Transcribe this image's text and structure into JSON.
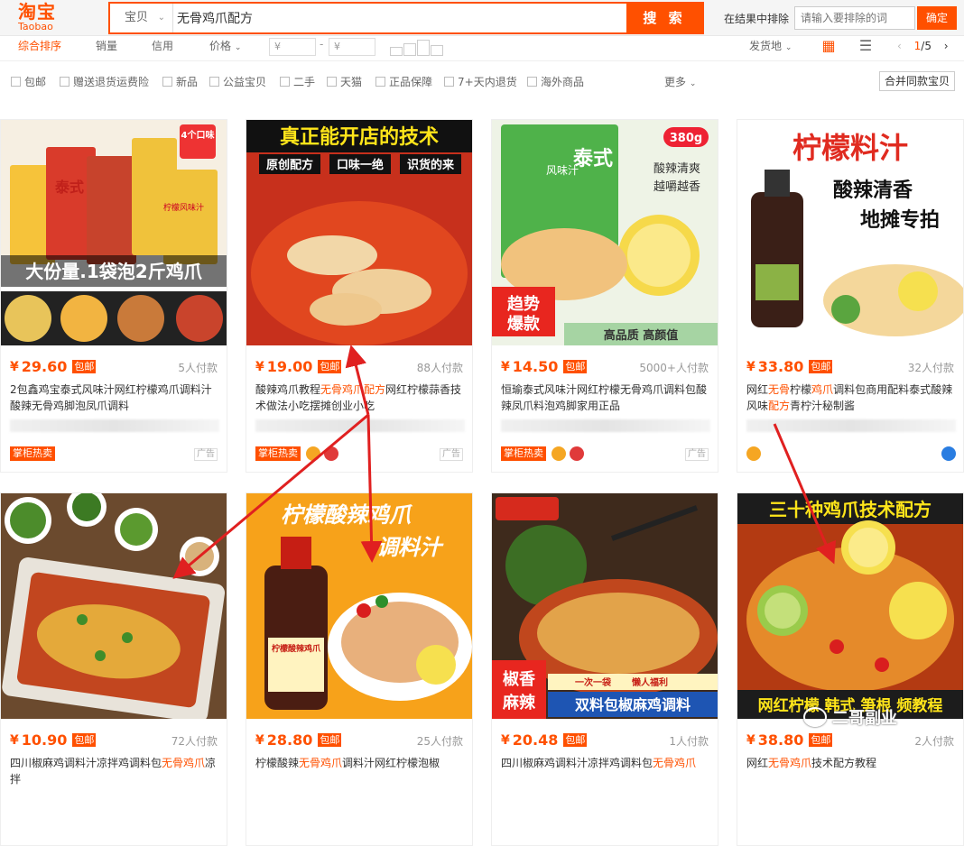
{
  "logo": {
    "cn": "淘宝",
    "en": "Taobao"
  },
  "search": {
    "scope": "宝贝",
    "query": "无骨鸡爪配方",
    "button": "搜 索"
  },
  "exclude": {
    "label": "在结果中排除",
    "placeholder": "请输入要排除的词",
    "button": "确定"
  },
  "sort": {
    "items": [
      "综合排序",
      "销量",
      "信用",
      "价格"
    ],
    "price_from": "¥",
    "price_to": "¥",
    "price_sep": "-",
    "ship_from": "发货地",
    "page": {
      "current": "1",
      "total": "/5"
    }
  },
  "filters": [
    "包邮",
    "赠送退货运费险",
    "新品",
    "公益宝贝",
    "二手",
    "天猫",
    "正品保障",
    "7+天内退货",
    "海外商品"
  ],
  "more": "更多",
  "merge": "合并同款宝贝",
  "products": [
    {
      "price": "29.60",
      "free": "包邮",
      "paid": "5人付款",
      "title_pre": "2包鑫鸡宝泰式风味汁网红柠檬鸡爪调料汁酸辣无骨鸡脚泡凤爪调料",
      "badge": "掌柜热卖",
      "ad": "广告",
      "img_text": [
        "大份量.1袋泡2斤鸡爪",
        "4个口味",
        "泰式",
        "柠檬风味汁"
      ]
    },
    {
      "price": "19.00",
      "free": "包邮",
      "paid": "88人付款",
      "title_pre": "酸辣鸡爪教程",
      "title_hl": "无骨鸡爪配方",
      "title_post": "网红柠檬蒜香技术做法小吃摆摊创业小吃",
      "badge": "掌柜热卖",
      "ad": "广告",
      "img_text": [
        "真正能开店的技术",
        "原创配方",
        "口味一绝",
        "识货的来"
      ]
    },
    {
      "price": "14.50",
      "free": "包邮",
      "paid": "5000+人付款",
      "title_pre": "恒瑜泰式风味汁网红柠檬无骨鸡爪调料包酸辣凤爪料泡鸡脚家用正品",
      "badge": "掌柜热卖",
      "ad": "广告",
      "img_text": [
        "泰式",
        "风味汁",
        "380g",
        "酸辣清爽",
        "越嚼越香",
        "趋势",
        "爆款",
        "高品质 高颜值"
      ]
    },
    {
      "price": "33.80",
      "free": "包邮",
      "paid": "32人付款",
      "title_pre": "网红",
      "title_hl": "无骨",
      "title_mid": "柠檬",
      "title_hl2": "鸡爪",
      "title_post": "调料包商用配料泰式酸辣风味",
      "title_hl3": "配方",
      "title_post2": "青柠汁秘制酱",
      "img_text": [
        "柠檬料汁",
        "酸辣清香",
        "地摊专拍"
      ]
    },
    {
      "price": "10.90",
      "free": "包邮",
      "paid": "72人付款",
      "title_pre": "四川椒麻鸡调料汁凉拌鸡调料包",
      "title_hl": "无骨鸡爪",
      "title_post": "凉拌"
    },
    {
      "price": "28.80",
      "free": "包邮",
      "paid": "25人付款",
      "title_pre": "柠檬酸辣",
      "title_hl": "无骨鸡爪",
      "title_post": "调料汁网红柠檬泡椒",
      "img_text": [
        "柠檬酸辣鸡爪",
        "调料汁",
        "柠檬酸辣鸡爪"
      ]
    },
    {
      "price": "20.48",
      "free": "包邮",
      "paid": "1人付款",
      "title_pre": "四川椒麻鸡调料汁凉拌鸡调料包",
      "title_hl": "无骨鸡爪",
      "img_text": [
        "椒香",
        "麻辣",
        "一次一袋",
        "懒人福利",
        "双料包椒麻鸡调料"
      ]
    },
    {
      "price": "38.80",
      "free": "包邮",
      "paid": "2人付款",
      "title_pre": "网红",
      "title_hl": "无骨鸡爪",
      "title_post": "技术配方教程",
      "img_text": [
        "三十种鸡爪技术配方",
        "网红柠檬 韩式 笋根 频教程"
      ]
    }
  ],
  "watermark": "二哥副业",
  "colors": {
    "brand": "#ff5000",
    "highlight": "#ff5000"
  }
}
